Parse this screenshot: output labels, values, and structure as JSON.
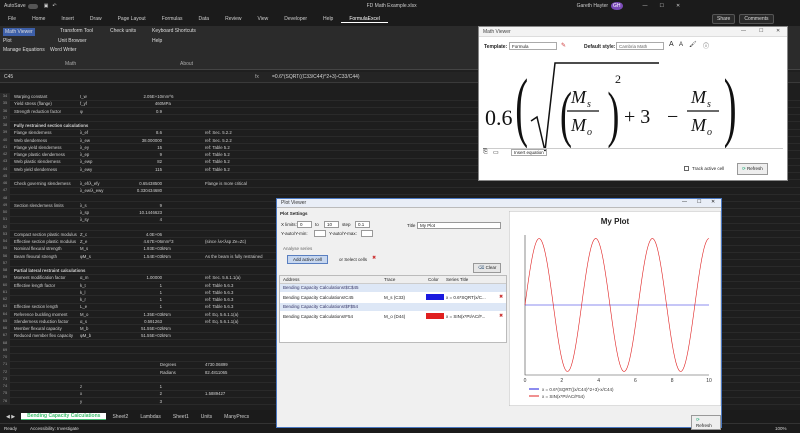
{
  "window": {
    "autosave": "AutoSave",
    "title": "FD Math Example.xlsx",
    "user": "Gareth Hayter",
    "user_initials": "GH"
  },
  "ribbon_tabs": [
    "File",
    "Home",
    "Insert",
    "Draw",
    "Page Layout",
    "Formulas",
    "Data",
    "Review",
    "View",
    "Developer",
    "Help",
    "FormulaExcel"
  ],
  "share_label": "Share",
  "comments_label": "Comments",
  "ribbon": {
    "math_viewer": "Math Viewer",
    "plot": "Plot",
    "manage_equations": "Manage Equations",
    "word_writer": "Word Writer",
    "transform_tool": "Transform Tool",
    "unit_browser": "Unit Browser",
    "check_units": "Check units",
    "keyboard_shortcuts": "Keyboard Shortcuts",
    "help": "Help",
    "group_math": "Math",
    "group_about": "About"
  },
  "formula_bar": {
    "name_box": "C45",
    "formula": "=0.6*(SQRT((C33/C44)^2+3)-C33/C44)"
  },
  "columns": [
    "A",
    "B",
    "C",
    "D",
    "E",
    "F",
    "G",
    "H",
    "I",
    "J",
    "K",
    "L",
    "M",
    "N"
  ],
  "rows": [
    {
      "n": "34",
      "a": "Warping constant",
      "b": "I_w",
      "c": "2.05E+10",
      "d": "mm^6"
    },
    {
      "n": "35",
      "a": "Yield stress (flange)",
      "b": "f_yf",
      "c": "460",
      "d": "MPa"
    },
    {
      "n": "36",
      "a": "Strength reduction factor",
      "b": "φ",
      "c": "0.9"
    },
    {
      "n": "37"
    },
    {
      "n": "38",
      "a": "Fully restrained section calculations"
    },
    {
      "n": "39",
      "a": "Flange slenderness",
      "b": "λ_ef",
      "c": "8.6",
      "f": "ref: Sec. 5.2.2"
    },
    {
      "n": "40",
      "a": "Web slenderness",
      "b": "λ_ew",
      "c": "38.000000",
      "f": "ref: Sec. 5.2.2"
    },
    {
      "n": "41",
      "a": "Flange yield slenderness",
      "b": "λ_ey",
      "c": "15",
      "f": "ref: Table 5.2"
    },
    {
      "n": "42",
      "a": "Flange plastic slenderness",
      "b": "λ_ep",
      "c": "9",
      "f": "ref: Table 5.2"
    },
    {
      "n": "43",
      "a": "Web plastic slenderness",
      "b": "λ_ewp",
      "c": "82",
      "f": "ref: Table 5.2"
    },
    {
      "n": "44",
      "a": "Web yield slenderness",
      "b": "λ_ewy",
      "c": "115",
      "f": "ref: Table 5.2"
    },
    {
      "n": "45"
    },
    {
      "n": "46",
      "a": "Check governing slenderness",
      "b": "λ_ef/λ_efy",
      "c": "0.65438500",
      "f": "Flange is more critical"
    },
    {
      "n": "47",
      "b": "λ_ew/λ_ewy",
      "c": "0.330434680"
    },
    {
      "n": "48"
    },
    {
      "n": "49",
      "a": "Section slenderness limits",
      "b": "λ_s",
      "c": "9"
    },
    {
      "n": "50",
      "b": "λ_sp",
      "c": "10.1446623"
    },
    {
      "n": "51",
      "b": "λ_sy",
      "c": "4"
    },
    {
      "n": "52"
    },
    {
      "n": "53",
      "a": "Compact section plastic modulus",
      "b": "Z_c",
      "c": "4.0E+06"
    },
    {
      "n": "54",
      "a": "Effective section plastic modulus",
      "b": "Z_e",
      "c": "4.67E+06",
      "d": "mm^3",
      "f": "(since λs<λsp Ze=Zc)"
    },
    {
      "n": "55",
      "a": "Nominal flexural strength",
      "b": "M_s",
      "c": "1.93E+03",
      "d": "kNm"
    },
    {
      "n": "56",
      "a": "Beam flexural strength",
      "b": "φM_s",
      "c": "1.54E+03",
      "d": "kNm",
      "f": "As the beam is fully restrained"
    },
    {
      "n": "57"
    },
    {
      "n": "58",
      "a": "Partial lateral restraint calculations"
    },
    {
      "n": "59",
      "a": "Moment modification factor",
      "b": "α_m",
      "c": "1.00000",
      "f": "ref: Sec. 5.6.1.1(a)"
    },
    {
      "n": "60",
      "a": "Effective length factor",
      "b": "k_t",
      "c": "1",
      "f": "ref: Table 5.6.3"
    },
    {
      "n": "61",
      "b": "k_l",
      "c": "1",
      "f": "ref: Table 5.6.3"
    },
    {
      "n": "62",
      "b": "k_r",
      "c": "1",
      "f": "ref: Table 5.6.3"
    },
    {
      "n": "63",
      "a": "Effective section length",
      "b": "L_e",
      "c": "1",
      "f": "ref: Table 5.6.3"
    },
    {
      "n": "64",
      "a": "Reference buckling moment",
      "b": "M_o",
      "c": "1.35E+03",
      "d": "kNm",
      "f": "ref: Eq. 5.6.1.1(a)"
    },
    {
      "n": "65",
      "a": "Slenderness reduction factor",
      "b": "α_s",
      "c": "0.591263",
      "f": "ref: Eq. 5.6.1.1(a)"
    },
    {
      "n": "66",
      "a": "Member flexural capacity",
      "b": "M_b",
      "c": "51.55E+02",
      "d": "kNm"
    },
    {
      "n": "67",
      "a": "Reduced member flex capacity",
      "b": "φM_b",
      "c": "51.55E+02",
      "d": "kNm"
    },
    {
      "n": "68"
    },
    {
      "n": "69"
    },
    {
      "n": "70"
    },
    {
      "n": "71",
      "e": "Degrees",
      "f": "4730.06899"
    },
    {
      "n": "72",
      "e": "Radians",
      "f": "82.4811065"
    },
    {
      "n": "73"
    },
    {
      "n": "74",
      "b": "z",
      "c": "1"
    },
    {
      "n": "75",
      "b": "x",
      "c": "2",
      "f": "1.5889427"
    },
    {
      "n": "76",
      "b": "y",
      "c": "3"
    }
  ],
  "sheet_tabs": [
    "Bending Capacity Calculations",
    "Sheet2",
    "Lambdas",
    "Sheet1",
    "Units",
    "ManyPrecs"
  ],
  "status": {
    "ready": "Ready",
    "accessibility": "Accessibility: Investigate",
    "zoom": "100%"
  },
  "math_viewer": {
    "title": "Math Viewer",
    "template_label": "Template:",
    "template_value": "Formula",
    "default_style_label": "Default style:",
    "default_style_value": "Cambria Math",
    "equation": "0.6 ( sqrt( (M_s/M_o)^2 + 3 ) − M_s/M_o )",
    "eq_coef": "0.6",
    "eq_num": "M",
    "eq_num_sub": "s",
    "eq_den": "M",
    "eq_den_sub": "o",
    "eq_exp": "2",
    "eq_plus": "+ 3",
    "eq_minus": "−",
    "insert_equation": "Insert equation",
    "track_active_cell": "Track active cell",
    "refresh": "Refresh"
  },
  "plot_viewer": {
    "title": "Plot Viewer",
    "settings_label": "Plot Settings",
    "x_min_label": "X limits:",
    "x_min": "0",
    "x_to": "to",
    "x_max": "10",
    "x_step_label": "step",
    "x_step": "0.1",
    "y_label": "Y-auto/Y-min:",
    "y_label2": "Y-auto/Y-max:",
    "title_label": "Title",
    "title_value": "My Plot",
    "analyse_label": "Analyse series",
    "add_active_cell": "Add active cell",
    "add_selected_cells": "or Select cells",
    "clear_label": "Clear",
    "col_address": "Address",
    "col_trace": "Trace",
    "col_color": "Color",
    "col_series_title": "Series Title",
    "series": [
      {
        "group": "Bending Capacity Calculations!$C$45",
        "address": "Bending Capacity Calculations!C45",
        "trace": "M_s (C33)",
        "title": "x = 0.6*SQRT(x/C...",
        "color": "#1a1adf"
      },
      {
        "group": "Bending Capacity Calculations!$F$54",
        "address": "Bending Capacity Calculations!F54",
        "trace": "M_o (D44)",
        "title": "x = SIN(x*PI/AC/F...",
        "color": "#e02020"
      }
    ],
    "refresh": "Refresh"
  },
  "chart_data": {
    "type": "line",
    "title": "My Plot",
    "xlim": [
      0,
      10
    ],
    "ylim": [
      -1,
      1
    ],
    "xticks": [
      "0",
      "2",
      "4",
      "6",
      "8",
      "10"
    ],
    "yticks": [],
    "series": [
      {
        "name": "x = 0.6*(SQRT((x/C44)^2+3)-x/C44)",
        "color": "#1a1adf",
        "x": [
          0,
          10
        ],
        "y": [
          0,
          0
        ]
      },
      {
        "name": "x = SIN(x*PI/AC/F54)",
        "color": "#e02020",
        "x": [
          0,
          0.8,
          1.6,
          2.4,
          3.2,
          4.0,
          4.8,
          5.6,
          6.4,
          7.2,
          8.0,
          8.8,
          9.6,
          10
        ],
        "y": [
          0,
          0.98,
          -0.2,
          -0.93,
          0.38,
          0.85,
          -0.55,
          -0.73,
          0.69,
          0.59,
          -0.81,
          -0.42,
          0.9,
          0.2
        ]
      }
    ]
  }
}
